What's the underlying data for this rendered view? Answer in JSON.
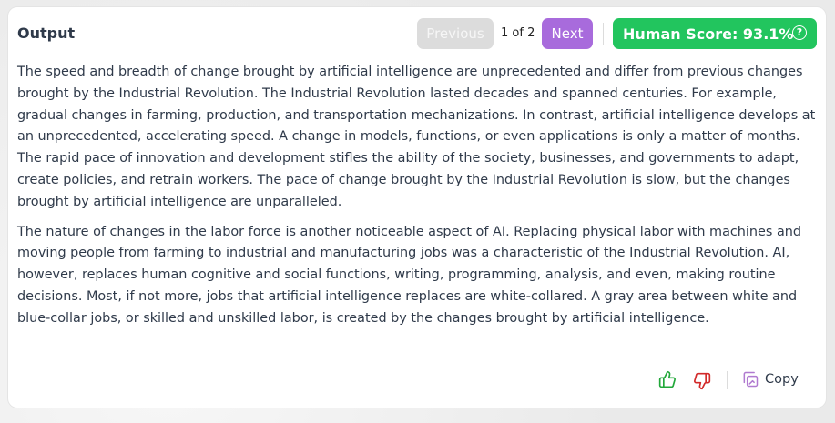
{
  "header": {
    "title": "Output",
    "prev_label": "Previous",
    "page_indicator": "1 of 2",
    "next_label": "Next",
    "score_label": "Human Score: 93.1%",
    "help_glyph": "?"
  },
  "content": {
    "paragraphs": [
      "The speed and breadth of change brought by artificial intelligence are unprecedented and differ from previous changes brought by the Industrial Revolution. The Industrial Revolution lasted decades and spanned centuries. For example, gradual changes in farming, production, and transportation mechanizations. In contrast, artificial intelligence develops at an unprecedented, accelerating speed. A change in models, functions, or even applications is only a matter of months. The rapid pace of innovation and development stifles the ability of the society, businesses, and governments to adapt, create policies, and retrain workers. The pace of change brought by the Industrial Revolution is slow, but the changes brought by artificial intelligence are unparalleled.",
      "The nature of changes in the labor force is another noticeable aspect of AI. Replacing physical labor with machines and moving people from farming to industrial and manufacturing jobs was a characteristic of the Industrial Revolution. AI, however, replaces human cognitive and social functions, writing, programming, analysis, and even, making routine decisions. Most, if not more, jobs that artificial intelligence replaces are white-collared. A gray area between white and blue-collar jobs, or skilled and unskilled labor, is created by the changes brought by artificial intelligence."
    ]
  },
  "footer": {
    "copy_label": "Copy"
  },
  "icons": {
    "thumbs_up": "thumbs-up-icon",
    "thumbs_down": "thumbs-down-icon",
    "copy": "copy-icon",
    "help": "help-circle-icon"
  },
  "colors": {
    "score_green": "#22c55e",
    "next_purple": "#a86bdc",
    "prev_disabled": "#dcdcdc",
    "thumbs_up_green": "#22a83a",
    "thumbs_down_red": "#d22a2a",
    "copy_icon_purple": "#b07ad0"
  }
}
